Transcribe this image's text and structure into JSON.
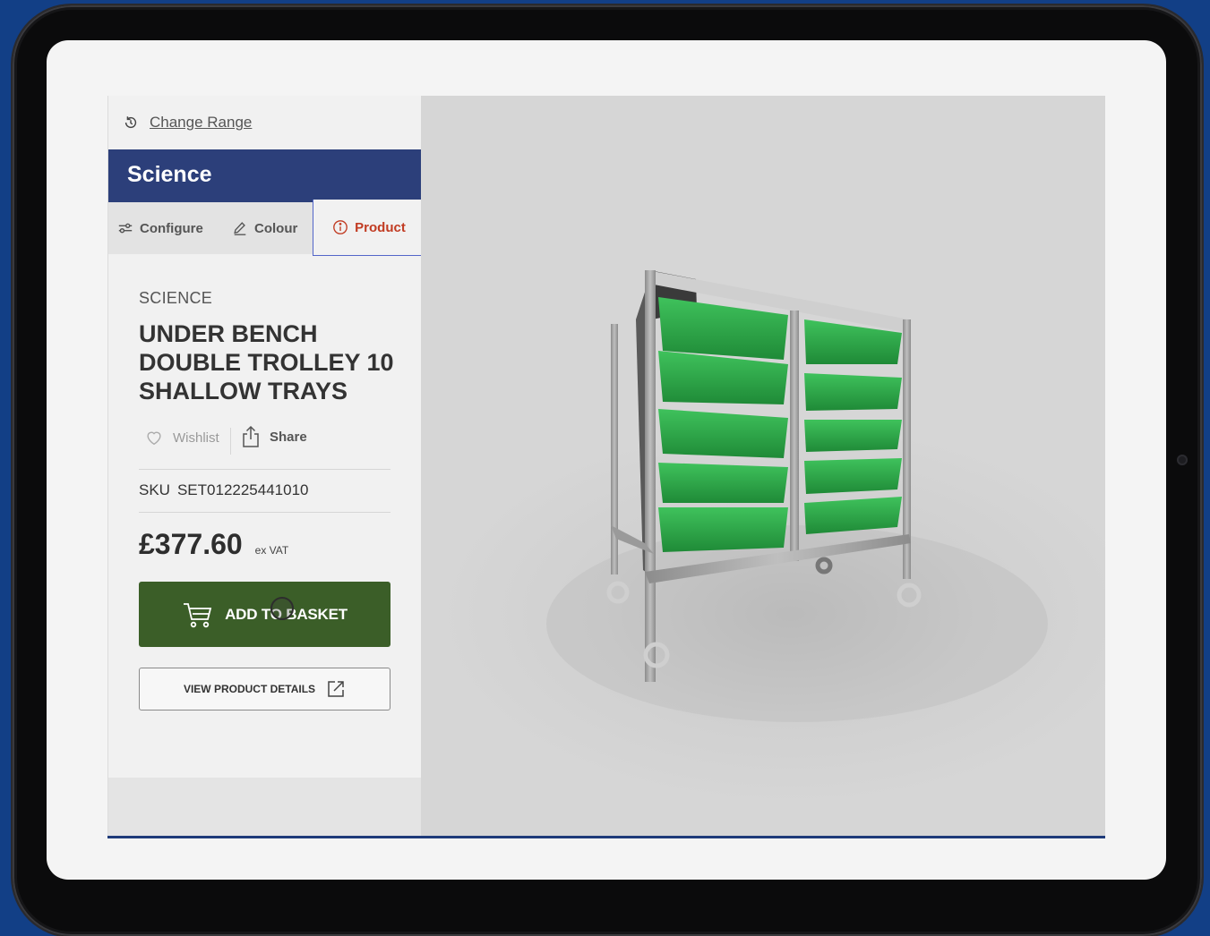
{
  "sidebar": {
    "change_range_label": "Change Range",
    "range_title": "Science",
    "tabs": [
      {
        "label": "Configure"
      },
      {
        "label": "Colour"
      },
      {
        "label": "Product"
      }
    ]
  },
  "product": {
    "category": "SCIENCE",
    "title": "UNDER BENCH DOUBLE TROLLEY 10 SHALLOW TRAYS",
    "wishlist_label": "Wishlist",
    "share_label": "Share",
    "sku_label": "SKU",
    "sku_value": "SET012225441010",
    "price": "£377.60",
    "vat_note": "ex VAT",
    "add_to_basket_label": "ADD TO BASKET",
    "view_details_label": "VIEW PRODUCT DETAILS"
  },
  "colors": {
    "header_blue": "#2c3f7a",
    "basket_green": "#3b5e28",
    "active_tab_text": "#c13b22",
    "tray_green": "#2faa4a"
  },
  "icons": [
    "history-icon",
    "sliders-icon",
    "pencil-icon",
    "info-icon",
    "heart-icon",
    "share-icon",
    "cart-icon",
    "external-link-icon"
  ]
}
